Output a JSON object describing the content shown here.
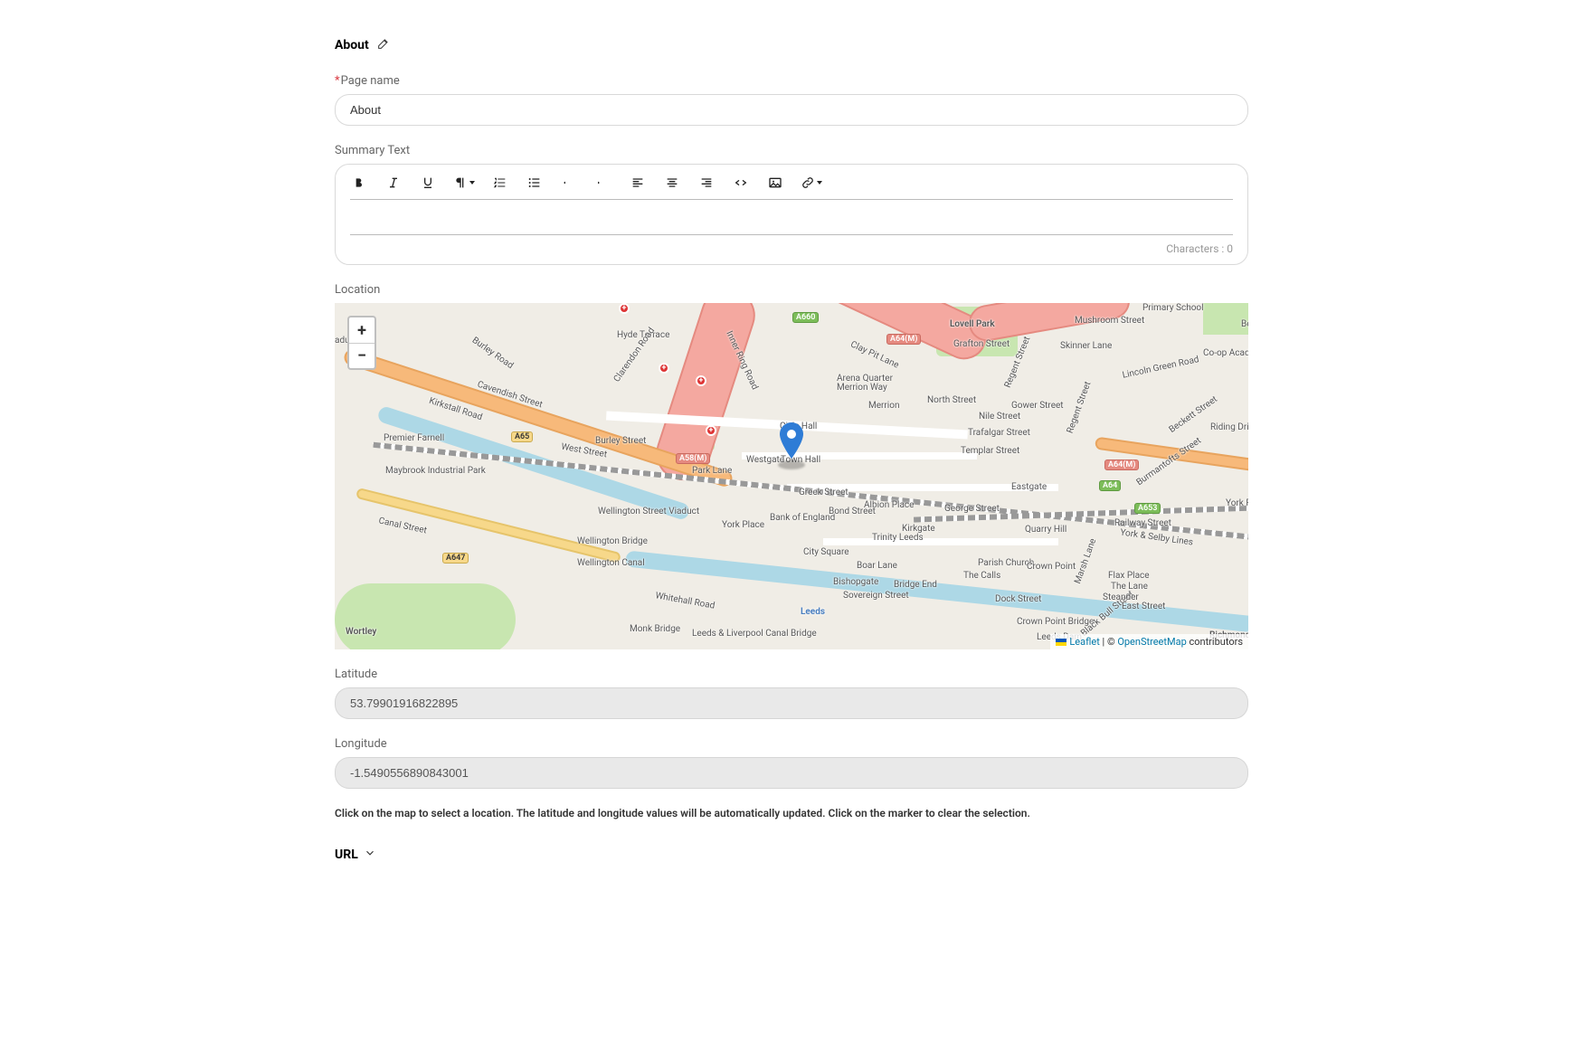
{
  "header": {
    "title": "About"
  },
  "fields": {
    "page_name": {
      "label": "Page name",
      "value": "About",
      "required": true
    },
    "summary": {
      "label": "Summary Text",
      "char_count_label": "Characters : 0"
    },
    "location": {
      "label": "Location"
    },
    "latitude": {
      "label": "Latitude",
      "value": "53.79901916822895"
    },
    "longitude": {
      "label": "Longitude",
      "value": "-1.5490556890843001"
    },
    "help": "Click on the map to select a location. The latitude and longitude values will be automatically updated. Click on the marker to clear the selection.",
    "url_section": {
      "label": "URL"
    }
  },
  "map": {
    "zoom_in": "+",
    "zoom_out": "−",
    "attribution": {
      "leaflet": "Leaflet",
      "sep": " | © ",
      "osm": "OpenStreetMap",
      "tail": " contributors"
    },
    "labels": {
      "lovell_park": "Lovell Park",
      "arena_quarter": "Arena Quarter",
      "civic_hall": "Civic Hall",
      "merrion": "Merrion",
      "north_street": "North Street",
      "trinity": "Trinity Leeds",
      "city_square": "City Square",
      "bishopgate": "Bishopgate",
      "bridge_end": "Bridge End",
      "the_calls": "The Calls",
      "parish_church": "Parish Church",
      "crown_point": "Crown Point",
      "crown_point_bridge": "Crown Point Bridge",
      "leeds_dam": "Leeds Dam",
      "quarry_hill": "Quarry Hill",
      "eastgate": "Eastgate",
      "richmond_hill": "Richmond Hill",
      "wellington_viaduct": "Wellington Street Viaduct",
      "wellington_bridge": "Wellington Bridge",
      "wellington_canal": "Wellington Canal",
      "canal_street": "Canal Street",
      "maybrook": "Maybrook Industrial Park",
      "premier_farnell": "Premier Farnell",
      "wortley": "Wortley",
      "kirkstall": "Kirkstall Road",
      "west_street": "West Street",
      "park_lane": "Park Lane",
      "westgate": "Westgate",
      "greek_st": "Greek Street",
      "bank_of_england": "Bank of England",
      "york_place": "York Place",
      "burley_street": "Burley Street",
      "burley_road": "Burley Road",
      "hyde_terrace": "Hyde Terrace",
      "clarendon": "Clarendon Road",
      "inner_ring": "Inner Ring Road",
      "clay_pit": "Clay Pit Lane",
      "merrion_way": "Merrion Way",
      "regent": "Regent Street",
      "skinner": "Skinner Lane",
      "lincoln_green": "Lincoln Green Road",
      "beckett": "Beckett Street",
      "york_road": "York Road",
      "york_selby": "York & Selby Lines",
      "railway_st": "Railway Street",
      "black_bull": "Black Bull Street",
      "marsh_lane": "Marsh Lane",
      "east_street": "East Street",
      "dock_street": "Dock Street",
      "sovereign": "Sovereign Street",
      "boar_lane": "Boar Lane",
      "kirkgate": "Kirkgate",
      "albion_place": "Albion Place",
      "george_st": "George Street",
      "templar": "Templar Street",
      "nile_st": "Nile Street",
      "trafalgar": "Trafalgar Street",
      "gower": "Gower Street",
      "grafton": "Grafton Street",
      "cavendish": "Cavendish Street",
      "whitehall": "Whitehall Road",
      "monk_bridge": "Monk Bridge",
      "leeds_liverpool": "Leeds & Liverpool Canal Bridge",
      "leeds": "Leeds",
      "bond_st": "Bond Street",
      "aduct": "aduct",
      "primary_school": "Primary School",
      "coop_academy": "Co-op Academy Leeds",
      "beckett_arms": "Beckett Arms Corridor",
      "mushroom_st": "Mushroom Street",
      "flax_place": "Flax Place",
      "the_lane": "The Lane",
      "steander": "Steander",
      "burmantofts": "Burmantofts Street",
      "riding_drive": "Riding Drive",
      "regent2": "Regent Street",
      "town_hall": "Town Hall"
    },
    "badges": {
      "a65": "A65",
      "a647": "A647",
      "a660": "A660",
      "a64m1": "A64(M)",
      "a64m2": "A64(M)",
      "a58m": "A58(M)",
      "a653": "A653",
      "a64": "A64"
    }
  }
}
